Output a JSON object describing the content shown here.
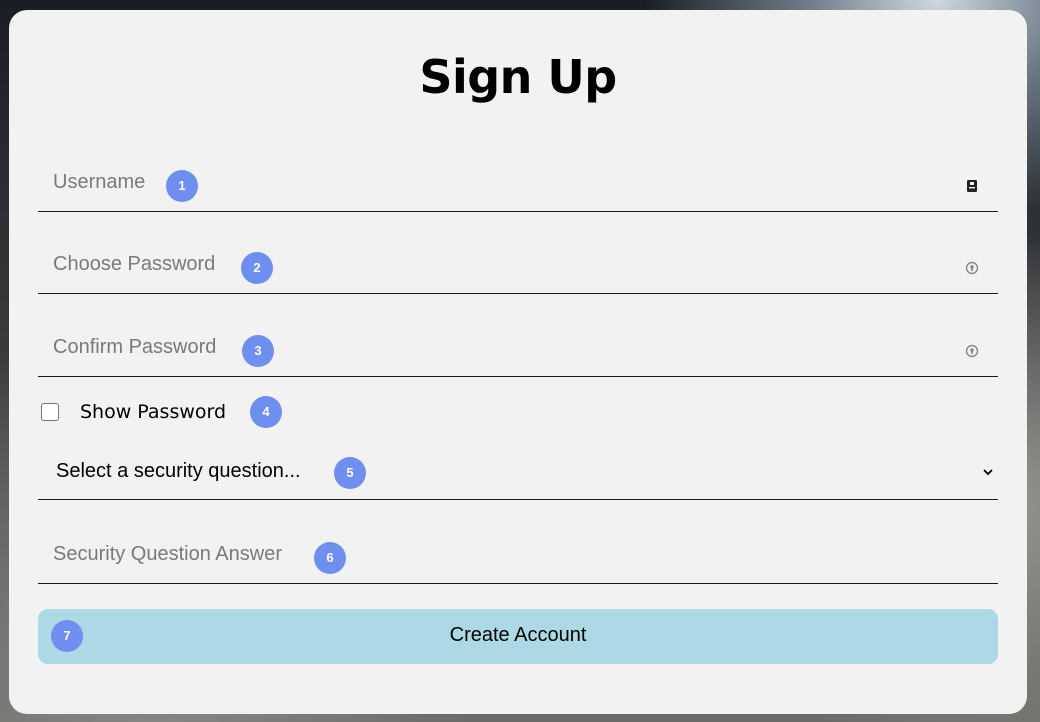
{
  "form": {
    "title": "Sign Up",
    "username": {
      "placeholder": "Username",
      "badge": "1",
      "icon": "id-card-icon"
    },
    "choose_password": {
      "placeholder": "Choose Password",
      "badge": "2",
      "icon": "lock-icon"
    },
    "confirm_password": {
      "placeholder": "Confirm Password",
      "badge": "3",
      "icon": "lock-icon"
    },
    "show_password": {
      "label": "Show Password",
      "checked": false,
      "badge": "4"
    },
    "security_question": {
      "selected": "Select a security question...",
      "badge": "5",
      "icon": "chevron-down-icon"
    },
    "security_answer": {
      "placeholder": "Security Question Answer",
      "badge": "6"
    },
    "submit": {
      "label": "Create Account",
      "badge": "7"
    }
  },
  "colors": {
    "card_background": "#f2f2f2",
    "badge": "#6f8ff0",
    "button": "#add8e6",
    "placeholder_text": "#7a7a7a"
  }
}
